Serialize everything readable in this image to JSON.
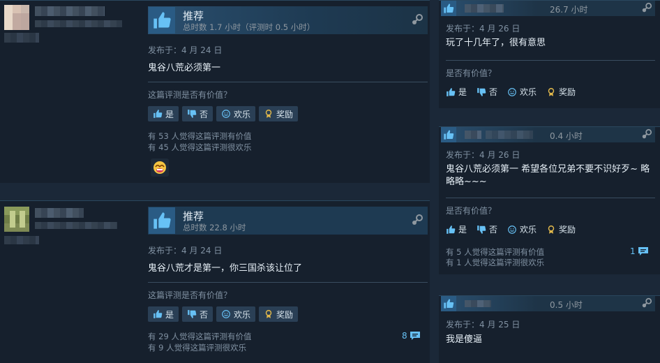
{
  "labels": {
    "posted_prefix": "发布于：",
    "helpful_question": "这篇评测是否有价值？",
    "right_helpful_question": "是否有价值？",
    "btn_yes": "是",
    "btn_no": "否",
    "btn_funny": "欢乐",
    "btn_award": "奖励"
  },
  "icons": {
    "thumb": "thumbs-up-icon",
    "gear": "steam-icon",
    "yes": "thumbs-up-icon",
    "no": "thumbs-down-icon",
    "funny": "smiley-icon",
    "award": "award-icon",
    "comment": "comment-bubble-icon"
  },
  "colors": {
    "accent": "#66c0f4",
    "award": "#e1b84b",
    "panel": "#16202d"
  },
  "reviews": [
    {
      "recommendation": "推荐",
      "hours": "总时数 1.7 小时（评测时 0.5 小时）",
      "posted": "发布于：4 月 24 日",
      "content": "鬼谷八荒必须第一",
      "helpful_stat": "有 53 人觉得这篇评测有价值",
      "funny_stat": "有 45 人觉得这篇评测很欢乐"
    },
    {
      "recommendation": "推荐",
      "hours": "总时数 22.8 小时",
      "posted": "发布于：4 月 24 日",
      "content": "鬼谷八荒才是第一，你三国杀该让位了",
      "helpful_stat": "有 29 人觉得这篇评测有价值",
      "funny_stat": "有 9 人觉得这篇评测很欢乐",
      "comments": "8"
    }
  ],
  "side_reviews": [
    {
      "hours": "26.7 小时",
      "posted": "发布于：4 月 26 日",
      "content": "玩了十几年了，很有意思"
    },
    {
      "hours": "0.4 小时",
      "posted": "发布于：4 月 26 日",
      "content": "鬼谷八荒必须第一 希望各位兄弟不要不识好歹~ 略略略~~~",
      "helpful_stat": "有 5 人觉得这篇评测有价值",
      "funny_stat": "有 1 人觉得这篇评测很欢乐",
      "comments": "1"
    },
    {
      "hours": "0.5 小时",
      "posted": "发布于：4 月 25 日",
      "content": "我是傻逼"
    }
  ]
}
